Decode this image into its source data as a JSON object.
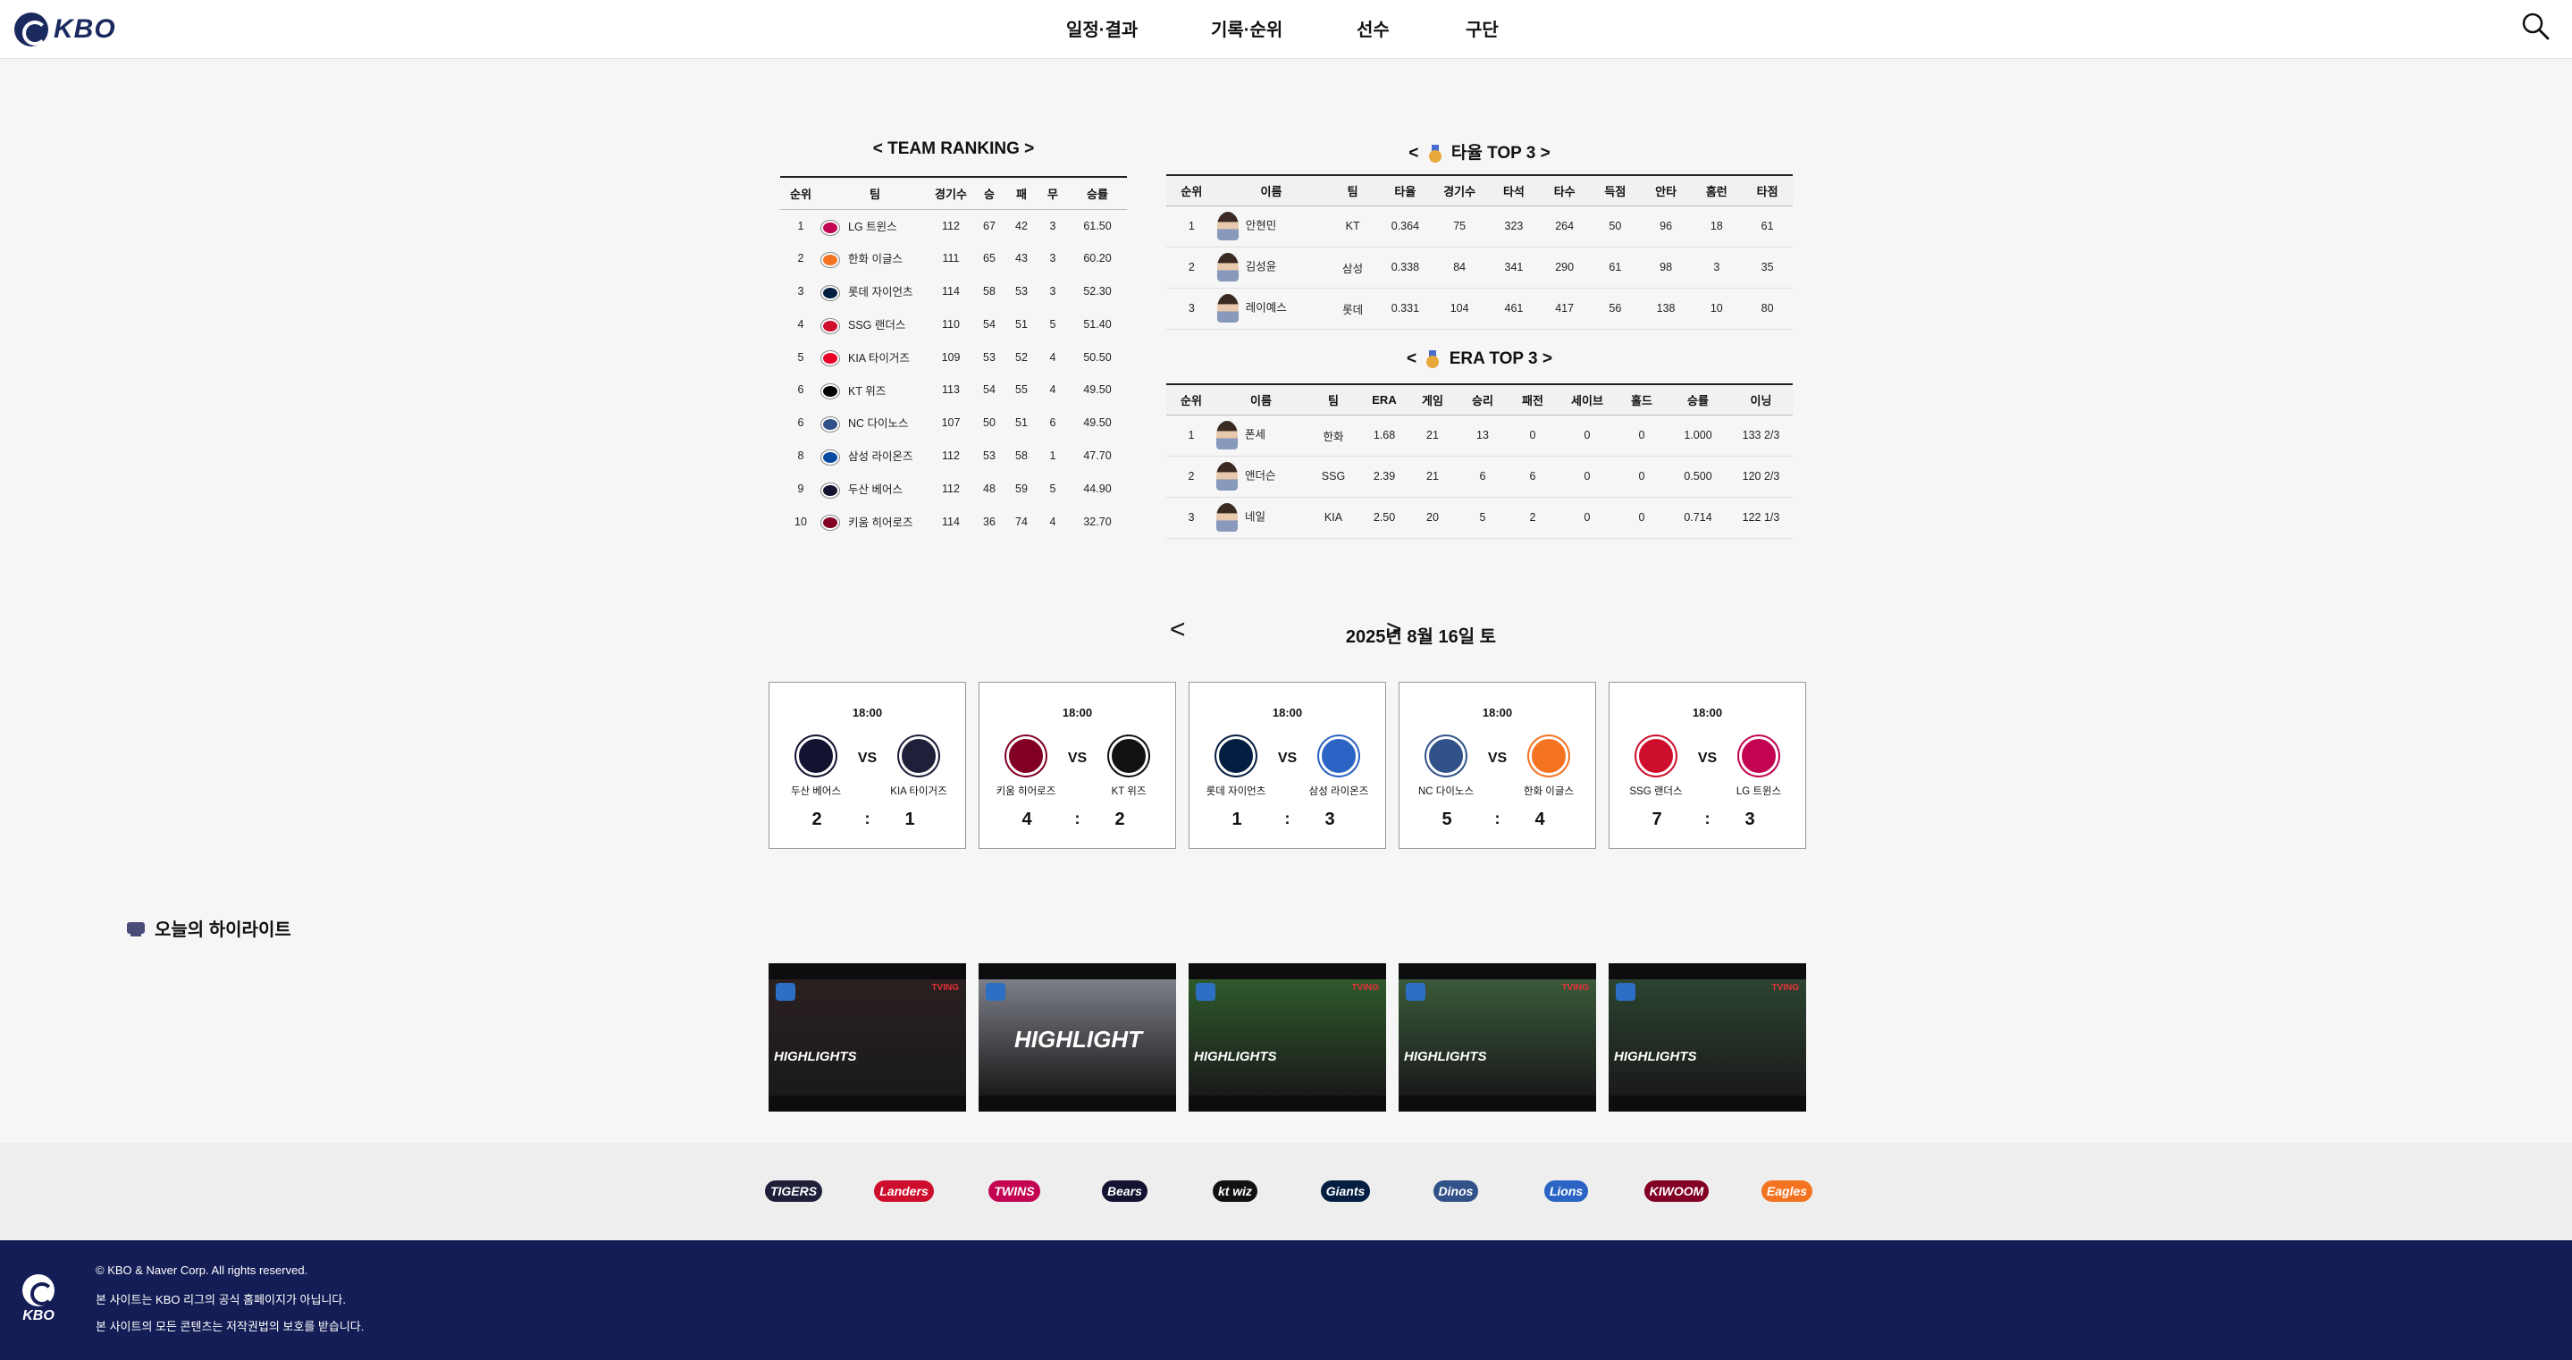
{
  "header": {
    "logo_text": "KBO",
    "nav": [
      "일정·결과",
      "기록·순위",
      "선수",
      "구단"
    ]
  },
  "team_ranking": {
    "title": "< TEAM RANKING >",
    "columns": [
      "순위",
      "팀",
      "경기수",
      "승",
      "패",
      "무",
      "승률"
    ],
    "rows": [
      {
        "rank": "1",
        "team": "LG 트윈스",
        "games": "112",
        "w": "67",
        "l": "42",
        "d": "3",
        "pct": "61.50",
        "color": "#c30452"
      },
      {
        "rank": "2",
        "team": "한화 이글스",
        "games": "111",
        "w": "65",
        "l": "43",
        "d": "3",
        "pct": "60.20",
        "color": "#f37321"
      },
      {
        "rank": "3",
        "team": "롯데 자이언츠",
        "games": "114",
        "w": "58",
        "l": "53",
        "d": "3",
        "pct": "52.30",
        "color": "#041e42"
      },
      {
        "rank": "4",
        "team": "SSG 랜더스",
        "games": "110",
        "w": "54",
        "l": "51",
        "d": "5",
        "pct": "51.40",
        "color": "#ce0e2d"
      },
      {
        "rank": "5",
        "team": "KIA 타이거즈",
        "games": "109",
        "w": "53",
        "l": "52",
        "d": "4",
        "pct": "50.50",
        "color": "#ea0029"
      },
      {
        "rank": "6",
        "team": "KT 위즈",
        "games": "113",
        "w": "54",
        "l": "55",
        "d": "4",
        "pct": "49.50",
        "color": "#000000"
      },
      {
        "rank": "6",
        "team": "NC 다이노스",
        "games": "107",
        "w": "50",
        "l": "51",
        "d": "6",
        "pct": "49.50",
        "color": "#315288"
      },
      {
        "rank": "8",
        "team": "삼성 라이온즈",
        "games": "112",
        "w": "53",
        "l": "58",
        "d": "1",
        "pct": "47.70",
        "color": "#074ca1"
      },
      {
        "rank": "9",
        "team": "두산 베어스",
        "games": "112",
        "w": "48",
        "l": "59",
        "d": "5",
        "pct": "44.90",
        "color": "#131230"
      },
      {
        "rank": "10",
        "team": "키움 히어로즈",
        "games": "114",
        "w": "36",
        "l": "74",
        "d": "4",
        "pct": "32.70",
        "color": "#820024"
      }
    ]
  },
  "batting_top3": {
    "title_left": "<",
    "title_text": "타율 TOP 3",
    "title_right": ">",
    "columns": [
      "순위",
      "이름",
      "팀",
      "타율",
      "경기수",
      "타석",
      "타수",
      "득점",
      "안타",
      "홈런",
      "타점"
    ],
    "rows": [
      {
        "rank": "1",
        "name": "안현민",
        "team": "KT",
        "avg": "0.364",
        "g": "75",
        "pa": "323",
        "ab": "264",
        "r": "50",
        "h": "96",
        "hr": "18",
        "rbi": "61"
      },
      {
        "rank": "2",
        "name": "김성윤",
        "team": "삼성",
        "avg": "0.338",
        "g": "84",
        "pa": "341",
        "ab": "290",
        "r": "61",
        "h": "98",
        "hr": "3",
        "rbi": "35"
      },
      {
        "rank": "3",
        "name": "레이예스",
        "team": "롯데",
        "avg": "0.331",
        "g": "104",
        "pa": "461",
        "ab": "417",
        "r": "56",
        "h": "138",
        "hr": "10",
        "rbi": "80"
      }
    ]
  },
  "era_top3": {
    "title_left": "<",
    "title_text": "ERA TOP 3",
    "title_right": ">",
    "columns": [
      "순위",
      "이름",
      "팀",
      "ERA",
      "게임",
      "승리",
      "패전",
      "세이브",
      "홀드",
      "승률",
      "이닝"
    ],
    "rows": [
      {
        "rank": "1",
        "name": "폰세",
        "team": "한화",
        "era": "1.68",
        "g": "21",
        "w": "13",
        "l": "0",
        "sv": "0",
        "hld": "0",
        "pct": "1.000",
        "ip": "133 2/3"
      },
      {
        "rank": "2",
        "name": "앤더슨",
        "team": "SSG",
        "era": "2.39",
        "g": "21",
        "w": "6",
        "l": "6",
        "sv": "0",
        "hld": "0",
        "pct": "0.500",
        "ip": "120 2/3"
      },
      {
        "rank": "3",
        "name": "네일",
        "team": "KIA",
        "era": "2.50",
        "g": "20",
        "w": "5",
        "l": "2",
        "sv": "0",
        "hld": "0",
        "pct": "0.714",
        "ip": "122 1/3"
      }
    ]
  },
  "schedule": {
    "prev": "<",
    "date": "2025년 8월 16일 토",
    "next": ">",
    "vs_label": "VS",
    "colon": ":",
    "games": [
      {
        "time": "18:00",
        "home": "두산 베어스",
        "away": "KIA 타이거즈",
        "home_score": "2",
        "away_score": "1",
        "home_color": "#131230",
        "away_color": "#1f1f3a"
      },
      {
        "time": "18:00",
        "home": "키움 히어로즈",
        "away": "KT 위즈",
        "home_score": "4",
        "away_score": "2",
        "home_color": "#820024",
        "away_color": "#111111"
      },
      {
        "time": "18:00",
        "home": "롯데 자이언츠",
        "away": "삼성 라이온즈",
        "home_score": "1",
        "away_score": "3",
        "home_color": "#041e42",
        "away_color": "#2b64c4"
      },
      {
        "time": "18:00",
        "home": "NC 다이노스",
        "away": "한화 이글스",
        "home_score": "5",
        "away_score": "4",
        "home_color": "#315288",
        "away_color": "#f37321"
      },
      {
        "time": "18:00",
        "home": "SSG 랜더스",
        "away": "LG 트윈스",
        "home_score": "7",
        "away_score": "3",
        "home_color": "#ce0e2d",
        "away_color": "#c30452"
      }
    ]
  },
  "highlights": {
    "title": "오늘의 하이라이트",
    "items": [
      {
        "label": "HIGHLIGHTS",
        "tving": "TVING",
        "scene": "#2a2020"
      },
      {
        "label": "HIGHLIGHT",
        "tving": "",
        "scene": "#7d7f88"
      },
      {
        "label": "HIGHLIGHTS",
        "tving": "TVING",
        "scene": "#2f5a2c"
      },
      {
        "label": "HIGHLIGHTS",
        "tving": "TVING",
        "scene": "#3a5a3a"
      },
      {
        "label": "HIGHLIGHTS",
        "tving": "TVING",
        "scene": "#2c4430"
      }
    ]
  },
  "team_logos": [
    {
      "name": "TIGERS",
      "color": "#1f1f3a"
    },
    {
      "name": "Landers",
      "color": "#ce0e2d"
    },
    {
      "name": "TWINS",
      "color": "#c30452"
    },
    {
      "name": "Bears",
      "color": "#131230"
    },
    {
      "name": "kt wiz",
      "color": "#111111"
    },
    {
      "name": "Giants",
      "color": "#041e42"
    },
    {
      "name": "Dinos",
      "color": "#315288"
    },
    {
      "name": "Lions",
      "color": "#2b64c4"
    },
    {
      "name": "KIWOOM",
      "color": "#820024"
    },
    {
      "name": "Eagles",
      "color": "#f37321"
    }
  ],
  "footer": {
    "logo_text": "KBO",
    "lines": [
      "© KBO & Naver Corp. All rights reserved.",
      "본 사이트는 KBO 리그의 공식 홈페이지가 아닙니다.",
      "본 사이트의 모든 콘텐츠는 저작권법의 보호를 받습니다."
    ]
  }
}
